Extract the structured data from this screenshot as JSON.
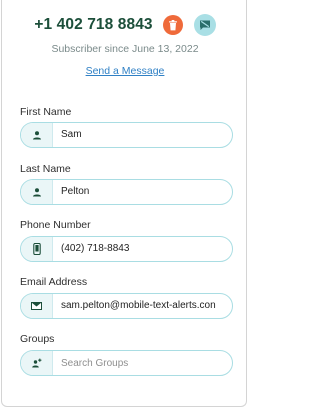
{
  "header": {
    "phone": "+1 402 718 8843",
    "delete_icon": "trash-icon",
    "block_icon": "message-blocked-icon",
    "delete_color": "#ef6a3a",
    "block_color": "#a9dfe5"
  },
  "subscriber_since": "Subscriber since June 13, 2022",
  "send_message_label": "Send a Message",
  "fields": {
    "first_name": {
      "label": "First Name",
      "value": "Sam",
      "icon": "person-icon"
    },
    "last_name": {
      "label": "Last Name",
      "value": "Pelton",
      "icon": "person-icon"
    },
    "phone": {
      "label": "Phone Number",
      "value": "(402) 718-8843",
      "icon": "mobile-phone-icon"
    },
    "email": {
      "label": "Email Address",
      "value": "sam.pelton@mobile-text-alerts.con",
      "icon": "envelope-icon"
    },
    "groups": {
      "label": "Groups",
      "placeholder": "Search Groups",
      "icon": "group-add-icon"
    }
  },
  "colors": {
    "accent_border": "#a9dde3",
    "icon_bg": "#eaf6f7",
    "title": "#1c4f3a",
    "link": "#2f80c5"
  }
}
